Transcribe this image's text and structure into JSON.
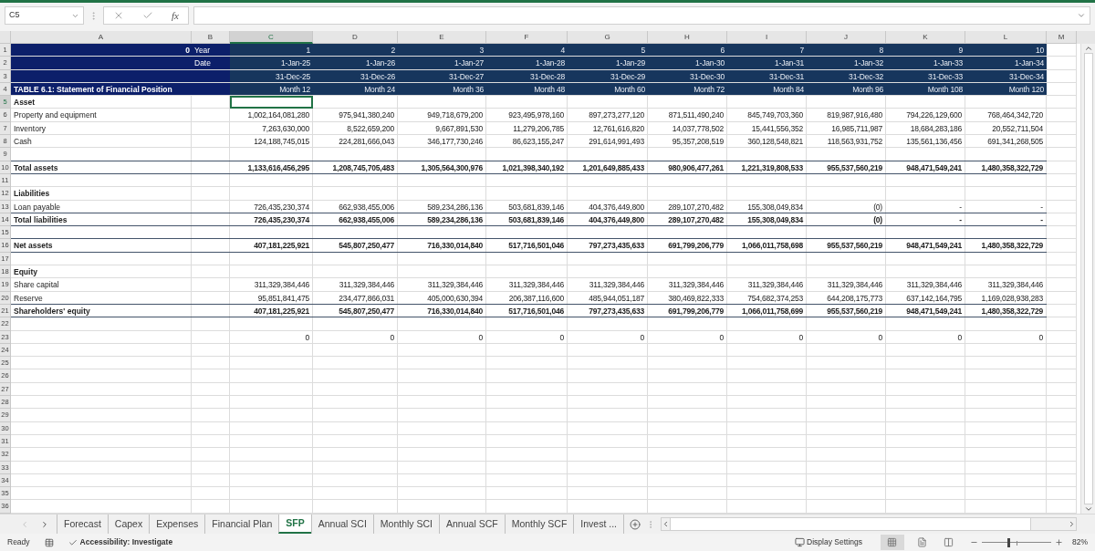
{
  "name_box": "C5",
  "function_label": "fx",
  "columns": [
    {
      "label": "A",
      "selected": false
    },
    {
      "label": "B",
      "selected": false
    },
    {
      "label": "C",
      "selected": true
    },
    {
      "label": "D",
      "selected": false
    },
    {
      "label": "E",
      "selected": false
    },
    {
      "label": "F",
      "selected": false
    },
    {
      "label": "G",
      "selected": false
    },
    {
      "label": "H",
      "selected": false
    },
    {
      "label": "I",
      "selected": false
    },
    {
      "label": "J",
      "selected": false
    },
    {
      "label": "K",
      "selected": false
    },
    {
      "label": "L",
      "selected": false
    },
    {
      "label": "M",
      "selected": false
    }
  ],
  "rows": [
    {
      "n": "1",
      "kind": "header",
      "selected": false,
      "a_number": "0",
      "b": "Year",
      "values": [
        "1",
        "2",
        "3",
        "4",
        "5",
        "6",
        "7",
        "8",
        "9",
        "10"
      ]
    },
    {
      "n": "2",
      "kind": "header",
      "selected": false,
      "b": "Date",
      "values": [
        "1-Jan-25",
        "1-Jan-26",
        "1-Jan-27",
        "1-Jan-28",
        "1-Jan-29",
        "1-Jan-30",
        "1-Jan-31",
        "1-Jan-32",
        "1-Jan-33",
        "1-Jan-34"
      ]
    },
    {
      "n": "3",
      "kind": "header",
      "selected": false,
      "values": [
        "31-Dec-25",
        "31-Dec-26",
        "31-Dec-27",
        "31-Dec-28",
        "31-Dec-29",
        "31-Dec-30",
        "31-Dec-31",
        "31-Dec-32",
        "31-Dec-33",
        "31-Dec-34"
      ]
    },
    {
      "n": "4",
      "kind": "header",
      "selected": false,
      "a": "TABLE 6.1: Statement of Financial Position",
      "values": [
        "Month 12",
        "Month 24",
        "Month 36",
        "Month 48",
        "Month 60",
        "Month 72",
        "Month 84",
        "Month 96",
        "Month 108",
        "Month 120"
      ]
    },
    {
      "n": "5",
      "kind": "section",
      "selected": true,
      "a": "Asset"
    },
    {
      "n": "6",
      "kind": "item",
      "selected": false,
      "a": "Property and equipment",
      "values": [
        "1,002,164,081,280",
        "975,941,380,240",
        "949,718,679,200",
        "923,495,978,160",
        "897,273,277,120",
        "871,511,490,240",
        "845,749,703,360",
        "819,987,916,480",
        "794,226,129,600",
        "768,464,342,720"
      ]
    },
    {
      "n": "7",
      "kind": "item",
      "selected": false,
      "a": "Inventory",
      "values": [
        "7,263,630,000",
        "8,522,659,200",
        "9,667,891,530",
        "11,279,206,785",
        "12,761,616,820",
        "14,037,778,502",
        "15,441,556,352",
        "16,985,711,987",
        "18,684,283,186",
        "20,552,711,504"
      ]
    },
    {
      "n": "8",
      "kind": "item",
      "selected": false,
      "a": "Cash",
      "values": [
        "124,188,745,015",
        "224,281,666,043",
        "346,177,730,246",
        "86,623,155,247",
        "291,614,991,493",
        "95,357,208,519",
        "360,128,548,821",
        "118,563,931,752",
        "135,561,136,456",
        "691,341,268,505"
      ]
    },
    {
      "n": "9",
      "kind": "blank",
      "selected": false,
      "rule_below": true
    },
    {
      "n": "10",
      "kind": "total",
      "selected": false,
      "rule_below": true,
      "a": "Total assets",
      "values": [
        "1,133,616,456,295",
        "1,208,745,705,483",
        "1,305,564,300,976",
        "1,021,398,340,192",
        "1,201,649,885,433",
        "980,906,477,261",
        "1,221,319,808,533",
        "955,537,560,219",
        "948,471,549,241",
        "1,480,358,322,729"
      ]
    },
    {
      "n": "11",
      "kind": "blank",
      "selected": false
    },
    {
      "n": "12",
      "kind": "section",
      "selected": false,
      "a": "Liabilities"
    },
    {
      "n": "13",
      "kind": "item",
      "selected": false,
      "rule_below": true,
      "a": "Loan payable",
      "values": [
        "726,435,230,374",
        "662,938,455,006",
        "589,234,286,136",
        "503,681,839,146",
        "404,376,449,800",
        "289,107,270,482",
        "155,308,049,834",
        "(0)",
        "-",
        "-"
      ]
    },
    {
      "n": "14",
      "kind": "total",
      "selected": false,
      "rule_below": true,
      "a": "Total liabilities",
      "values": [
        "726,435,230,374",
        "662,938,455,006",
        "589,234,286,136",
        "503,681,839,146",
        "404,376,449,800",
        "289,107,270,482",
        "155,308,049,834",
        "(0)",
        "-",
        "-"
      ]
    },
    {
      "n": "15",
      "kind": "blank",
      "selected": false,
      "rule_below": true
    },
    {
      "n": "16",
      "kind": "total",
      "selected": false,
      "rule_below": true,
      "a": "Net assets",
      "values": [
        "407,181,225,921",
        "545,807,250,477",
        "716,330,014,840",
        "517,716,501,046",
        "797,273,435,633",
        "691,799,206,779",
        "1,066,011,758,698",
        "955,537,560,219",
        "948,471,549,241",
        "1,480,358,322,729"
      ]
    },
    {
      "n": "17",
      "kind": "blank",
      "selected": false
    },
    {
      "n": "18",
      "kind": "section",
      "selected": false,
      "a": "Equity"
    },
    {
      "n": "19",
      "kind": "item",
      "selected": false,
      "a": "Share capital",
      "values": [
        "311,329,384,446",
        "311,329,384,446",
        "311,329,384,446",
        "311,329,384,446",
        "311,329,384,446",
        "311,329,384,446",
        "311,329,384,446",
        "311,329,384,446",
        "311,329,384,446",
        "311,329,384,446"
      ]
    },
    {
      "n": "20",
      "kind": "item",
      "selected": false,
      "rule_below": true,
      "a": "Reserve",
      "values": [
        "95,851,841,475",
        "234,477,866,031",
        "405,000,630,394",
        "206,387,116,600",
        "485,944,051,187",
        "380,469,822,333",
        "754,682,374,253",
        "644,208,175,773",
        "637,142,164,795",
        "1,169,028,938,283"
      ]
    },
    {
      "n": "21",
      "kind": "total",
      "selected": false,
      "rule_below": true,
      "a": "Shareholders' equity",
      "values": [
        "407,181,225,921",
        "545,807,250,477",
        "716,330,014,840",
        "517,716,501,046",
        "797,273,435,633",
        "691,799,206,779",
        "1,066,011,758,699",
        "955,537,560,219",
        "948,471,549,241",
        "1,480,358,322,729"
      ]
    },
    {
      "n": "22",
      "kind": "blank",
      "selected": false
    },
    {
      "n": "23",
      "kind": "item",
      "selected": false,
      "values": [
        "0",
        "0",
        "0",
        "0",
        "0",
        "0",
        "0",
        "0",
        "0",
        "0"
      ]
    },
    {
      "n": "24",
      "kind": "blank",
      "selected": false
    },
    {
      "n": "25",
      "kind": "blank",
      "selected": false
    },
    {
      "n": "26",
      "kind": "blank",
      "selected": false
    },
    {
      "n": "27",
      "kind": "blank",
      "selected": false
    },
    {
      "n": "28",
      "kind": "blank",
      "selected": false
    },
    {
      "n": "29",
      "kind": "blank",
      "selected": false
    },
    {
      "n": "30",
      "kind": "blank",
      "selected": false
    },
    {
      "n": "31",
      "kind": "blank",
      "selected": false
    },
    {
      "n": "32",
      "kind": "blank",
      "selected": false
    },
    {
      "n": "33",
      "kind": "blank",
      "selected": false
    },
    {
      "n": "34",
      "kind": "blank",
      "selected": false
    },
    {
      "n": "35",
      "kind": "blank",
      "selected": false
    },
    {
      "n": "36",
      "kind": "blank",
      "selected": false
    }
  ],
  "sheet_tabs": [
    {
      "label": "Forecast",
      "selected": false
    },
    {
      "label": "Capex",
      "selected": false
    },
    {
      "label": "Expenses",
      "selected": false
    },
    {
      "label": "Financial Plan",
      "selected": false
    },
    {
      "label": "SFP",
      "selected": true
    },
    {
      "label": "Annual SCI",
      "selected": false
    },
    {
      "label": "Monthly SCI",
      "selected": false
    },
    {
      "label": "Annual SCF",
      "selected": false
    },
    {
      "label": "Monthly SCF",
      "selected": false
    },
    {
      "label": "Invest ...",
      "selected": false
    }
  ],
  "status_bar": {
    "mode": "Ready",
    "accessibility": "Accessibility: Investigate",
    "display_settings": "Display Settings",
    "zoom": {
      "level": 0.38,
      "reading": "82%"
    }
  }
}
